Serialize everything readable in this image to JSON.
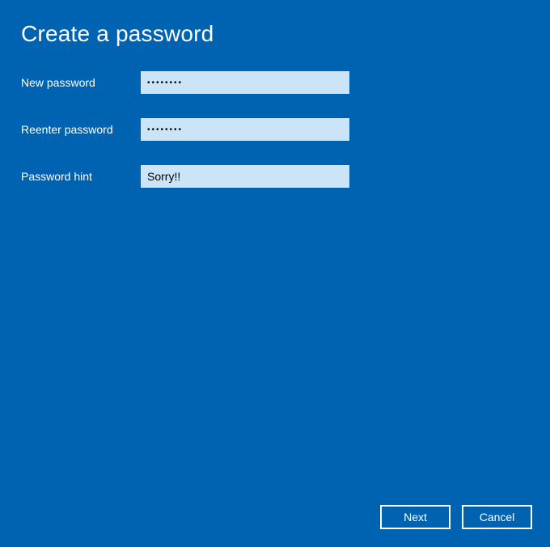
{
  "title": "Create a password",
  "fields": {
    "new_password": {
      "label": "New password",
      "value": "••••••••"
    },
    "reenter_password": {
      "label": "Reenter password",
      "value": "••••••••"
    },
    "password_hint": {
      "label": "Password hint",
      "value": "Sorry!!"
    }
  },
  "buttons": {
    "next": "Next",
    "cancel": "Cancel"
  }
}
